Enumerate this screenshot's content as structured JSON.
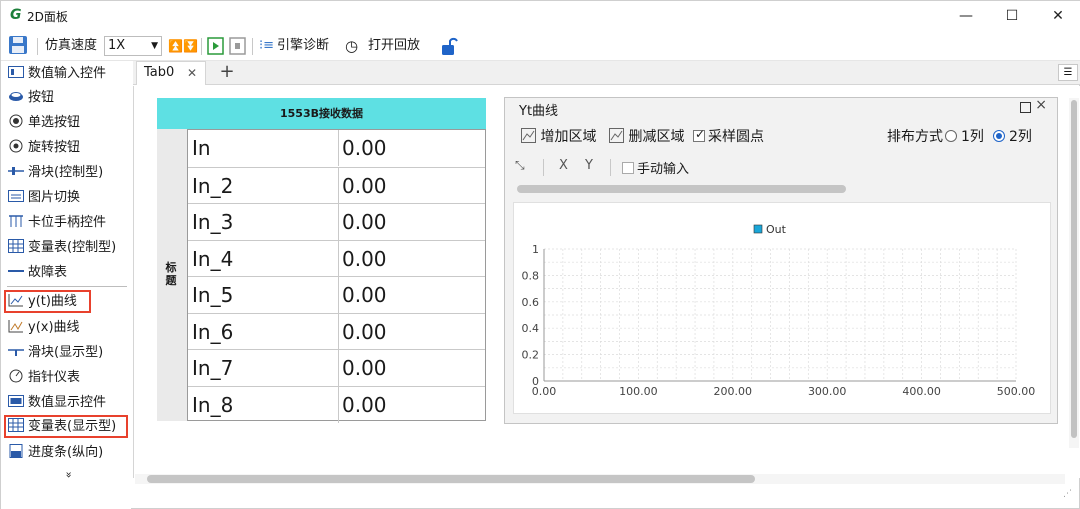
{
  "window": {
    "title": "2D面板",
    "minimize": "—",
    "maximize": "☐",
    "close": "✕"
  },
  "toolbar": {
    "speed_label": "仿真速度",
    "speed_value": "1X",
    "engine_diag": "引擎诊断",
    "open_playback": "打开回放"
  },
  "sidebar": {
    "items": [
      {
        "label": "数值输入控件",
        "icon": "numeric-input-icon"
      },
      {
        "label": "按钮",
        "icon": "button-icon"
      },
      {
        "label": "单选按钮",
        "icon": "radio-icon"
      },
      {
        "label": "旋转按钮",
        "icon": "rotary-icon"
      },
      {
        "label": "滑块(控制型)",
        "icon": "slider-icon"
      },
      {
        "label": "图片切换",
        "icon": "image-switch-icon"
      },
      {
        "label": "卡位手柄控件",
        "icon": "handle-icon"
      },
      {
        "label": "变量表(控制型)",
        "icon": "table-icon"
      },
      {
        "label": "故障表",
        "icon": "fault-table-icon"
      },
      {
        "label": "y(t)曲线",
        "icon": "yt-curve-icon",
        "highlighted": true
      },
      {
        "label": "y(x)曲线",
        "icon": "yx-curve-icon"
      },
      {
        "label": "滑块(显示型)",
        "icon": "slider-display-icon"
      },
      {
        "label": "指针仪表",
        "icon": "gauge-icon"
      },
      {
        "label": "数值显示控件",
        "icon": "numeric-display-icon"
      },
      {
        "label": "变量表(显示型)",
        "icon": "table-icon",
        "highlighted": true
      },
      {
        "label": "进度条(纵向)",
        "icon": "progress-icon"
      }
    ],
    "more": "»"
  },
  "tabs": [
    {
      "label": "Tab0"
    }
  ],
  "tab_close": "✕",
  "tab_add": "+",
  "table_widget": {
    "title": "1553B接收数据",
    "row_label": "标题",
    "rows": [
      {
        "name": "In",
        "value": "0.00"
      },
      {
        "name": "In_2",
        "value": "0.00"
      },
      {
        "name": "In_3",
        "value": "0.00"
      },
      {
        "name": "In_4",
        "value": "0.00"
      },
      {
        "name": "In_5",
        "value": "0.00"
      },
      {
        "name": "In_6",
        "value": "0.00"
      },
      {
        "name": "In_7",
        "value": "0.00"
      },
      {
        "name": "In_8",
        "value": "0.00"
      }
    ]
  },
  "yt_panel": {
    "title": "Yt曲线",
    "add_area": "增加区域",
    "del_area": "删减区域",
    "sample_dots": "采样圆点",
    "layout_label": "排布方式",
    "col1": "1列",
    "col2": "2列",
    "x_btn": "X",
    "y_btn": "Y",
    "manual_input": "手动输入"
  },
  "chart_data": {
    "type": "line",
    "series": [
      {
        "name": "Out",
        "values": []
      }
    ],
    "x_ticks": [
      "0.00",
      "100.00",
      "200.00",
      "300.00",
      "400.00",
      "500.00"
    ],
    "y_ticks": [
      "0",
      "0.2",
      "0.4",
      "0.6",
      "0.8",
      "1"
    ],
    "xlim": [
      0,
      500
    ],
    "ylim": [
      0,
      1
    ],
    "grid": true,
    "legend": "top-center",
    "series_color": "#1aa6d8"
  },
  "colors": {
    "table_header": "#5ee0e3",
    "highlight_border": "#e8412d",
    "accent": "#1f64c8"
  }
}
